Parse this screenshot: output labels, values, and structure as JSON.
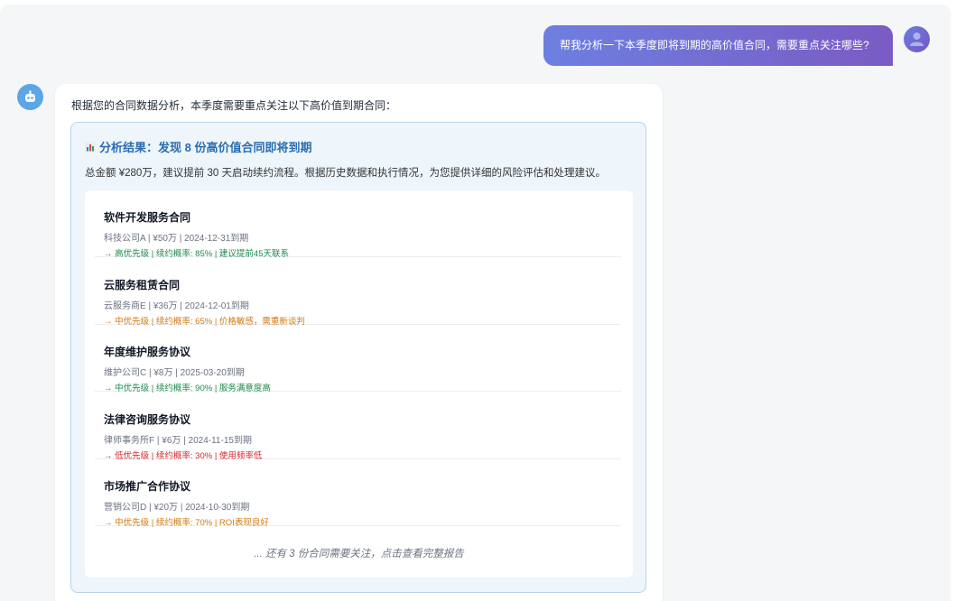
{
  "colors": {
    "high": "#1e8a4c",
    "medium": "#d27a12",
    "low": "#d6262a"
  },
  "user_message": "帮我分析一下本季度即将到期的高价值合同，需要重点关注哪些?",
  "assistant": {
    "intro": "根据您的合同数据分析，本季度需要重点关注以下高价值到期合同：",
    "result_title": "分析结果：发现 8 份高价值合同即将到期",
    "result_icon": "bar-chart-icon",
    "summary": "总金额 ¥280万，建议提前 30 天启动续约流程。根据历史数据和执行情况，为您提供详细的风险评估和处理建议。",
    "contracts": [
      {
        "name": "软件开发服务合同",
        "meta": "科技公司A | ¥50万 | 2024-12-31到期",
        "note": "→ 高优先级 | 续约概率: 85% | 建议提前45天联系",
        "level": "high"
      },
      {
        "name": "云服务租赁合同",
        "meta": "云服务商E | ¥36万 | 2024-12-01到期",
        "note": "→ 中优先级 | 续约概率: 65% | 价格敏感，需重新谈判",
        "level": "medium"
      },
      {
        "name": "年度维护服务协议",
        "meta": "维护公司C | ¥8万 | 2025-03-20到期",
        "note": "→ 中优先级 | 续约概率: 90% | 服务满意度高",
        "level": "high"
      },
      {
        "name": "法律咨询服务协议",
        "meta": "律师事务所F | ¥6万 | 2024-11-15到期",
        "note": "→ 低优先级 | 续约概率: 30% | 使用频率低",
        "level": "low"
      },
      {
        "name": "市场推广合作协议",
        "meta": "营销公司D | ¥20万 | 2024-10-30到期",
        "note": "→ 中优先级 | 续约概率: 70% | ROI表现良好",
        "level": "medium"
      }
    ],
    "more_text": "... 还有 3 份合同需要关注，点击查看完整报告"
  }
}
